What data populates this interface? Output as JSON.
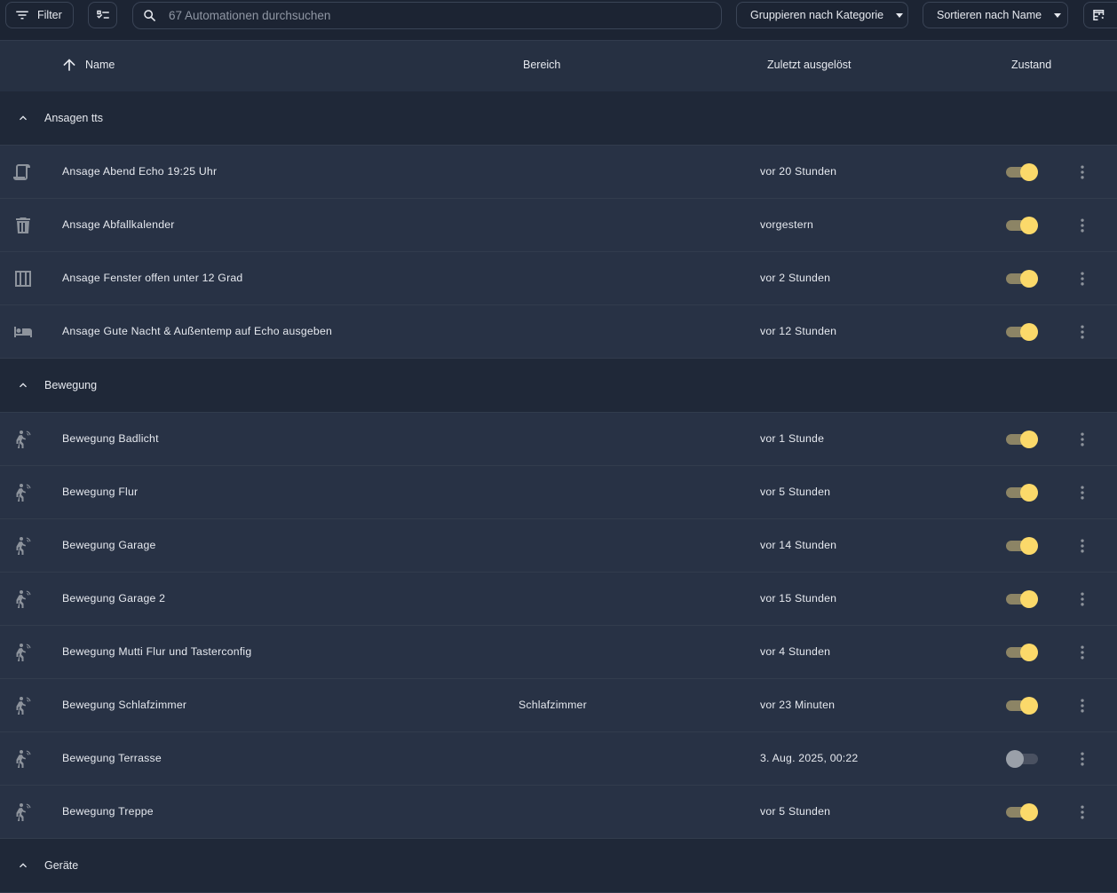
{
  "toolbar": {
    "filter_label": "Filter",
    "search_placeholder": "67 Automationen durchsuchen",
    "group_label": "Gruppieren nach Kategorie",
    "sort_label": "Sortieren nach Name"
  },
  "columns": {
    "name": "Name",
    "area": "Bereich",
    "last_triggered": "Zuletzt ausgelöst",
    "state": "Zustand"
  },
  "groups": [
    {
      "label": "Ansagen tts",
      "rows": [
        {
          "icon": "script-icon",
          "name": "Ansage Abend Echo 19:25 Uhr",
          "area": "",
          "last": "vor 20 Stunden",
          "enabled": true
        },
        {
          "icon": "trash-can-icon",
          "name": "Ansage Abfallkalender",
          "area": "",
          "last": "vorgestern",
          "enabled": true
        },
        {
          "icon": "window-icon",
          "name": "Ansage Fenster offen unter 12 Grad",
          "area": "",
          "last": "vor 2 Stunden",
          "enabled": true
        },
        {
          "icon": "bed-icon",
          "name": "Ansage Gute Nacht & Außentemp auf Echo ausgeben",
          "area": "",
          "last": "vor 12 Stunden",
          "enabled": true
        }
      ]
    },
    {
      "label": "Bewegung",
      "rows": [
        {
          "icon": "motion-sensor-icon",
          "name": "Bewegung Badlicht",
          "area": "",
          "last": "vor 1 Stunde",
          "enabled": true
        },
        {
          "icon": "motion-sensor-icon",
          "name": "Bewegung Flur",
          "area": "",
          "last": "vor 5 Stunden",
          "enabled": true
        },
        {
          "icon": "motion-sensor-icon",
          "name": "Bewegung Garage",
          "area": "",
          "last": "vor 14 Stunden",
          "enabled": true
        },
        {
          "icon": "motion-sensor-icon",
          "name": "Bewegung Garage 2",
          "area": "",
          "last": "vor 15 Stunden",
          "enabled": true
        },
        {
          "icon": "motion-sensor-icon",
          "name": "Bewegung Mutti Flur und Tasterconfig",
          "area": "",
          "last": "vor 4 Stunden",
          "enabled": true
        },
        {
          "icon": "motion-sensor-icon",
          "name": "Bewegung Schlafzimmer",
          "area": "Schlafzimmer",
          "last": "vor 23 Minuten",
          "enabled": true
        },
        {
          "icon": "motion-sensor-icon",
          "name": "Bewegung Terrasse",
          "area": "",
          "last": "3. Aug. 2025, 00:22",
          "enabled": false
        },
        {
          "icon": "motion-sensor-icon",
          "name": "Bewegung Treppe",
          "area": "",
          "last": "vor 5 Stunden",
          "enabled": true
        }
      ]
    },
    {
      "label": "Geräte",
      "rows": []
    }
  ]
}
